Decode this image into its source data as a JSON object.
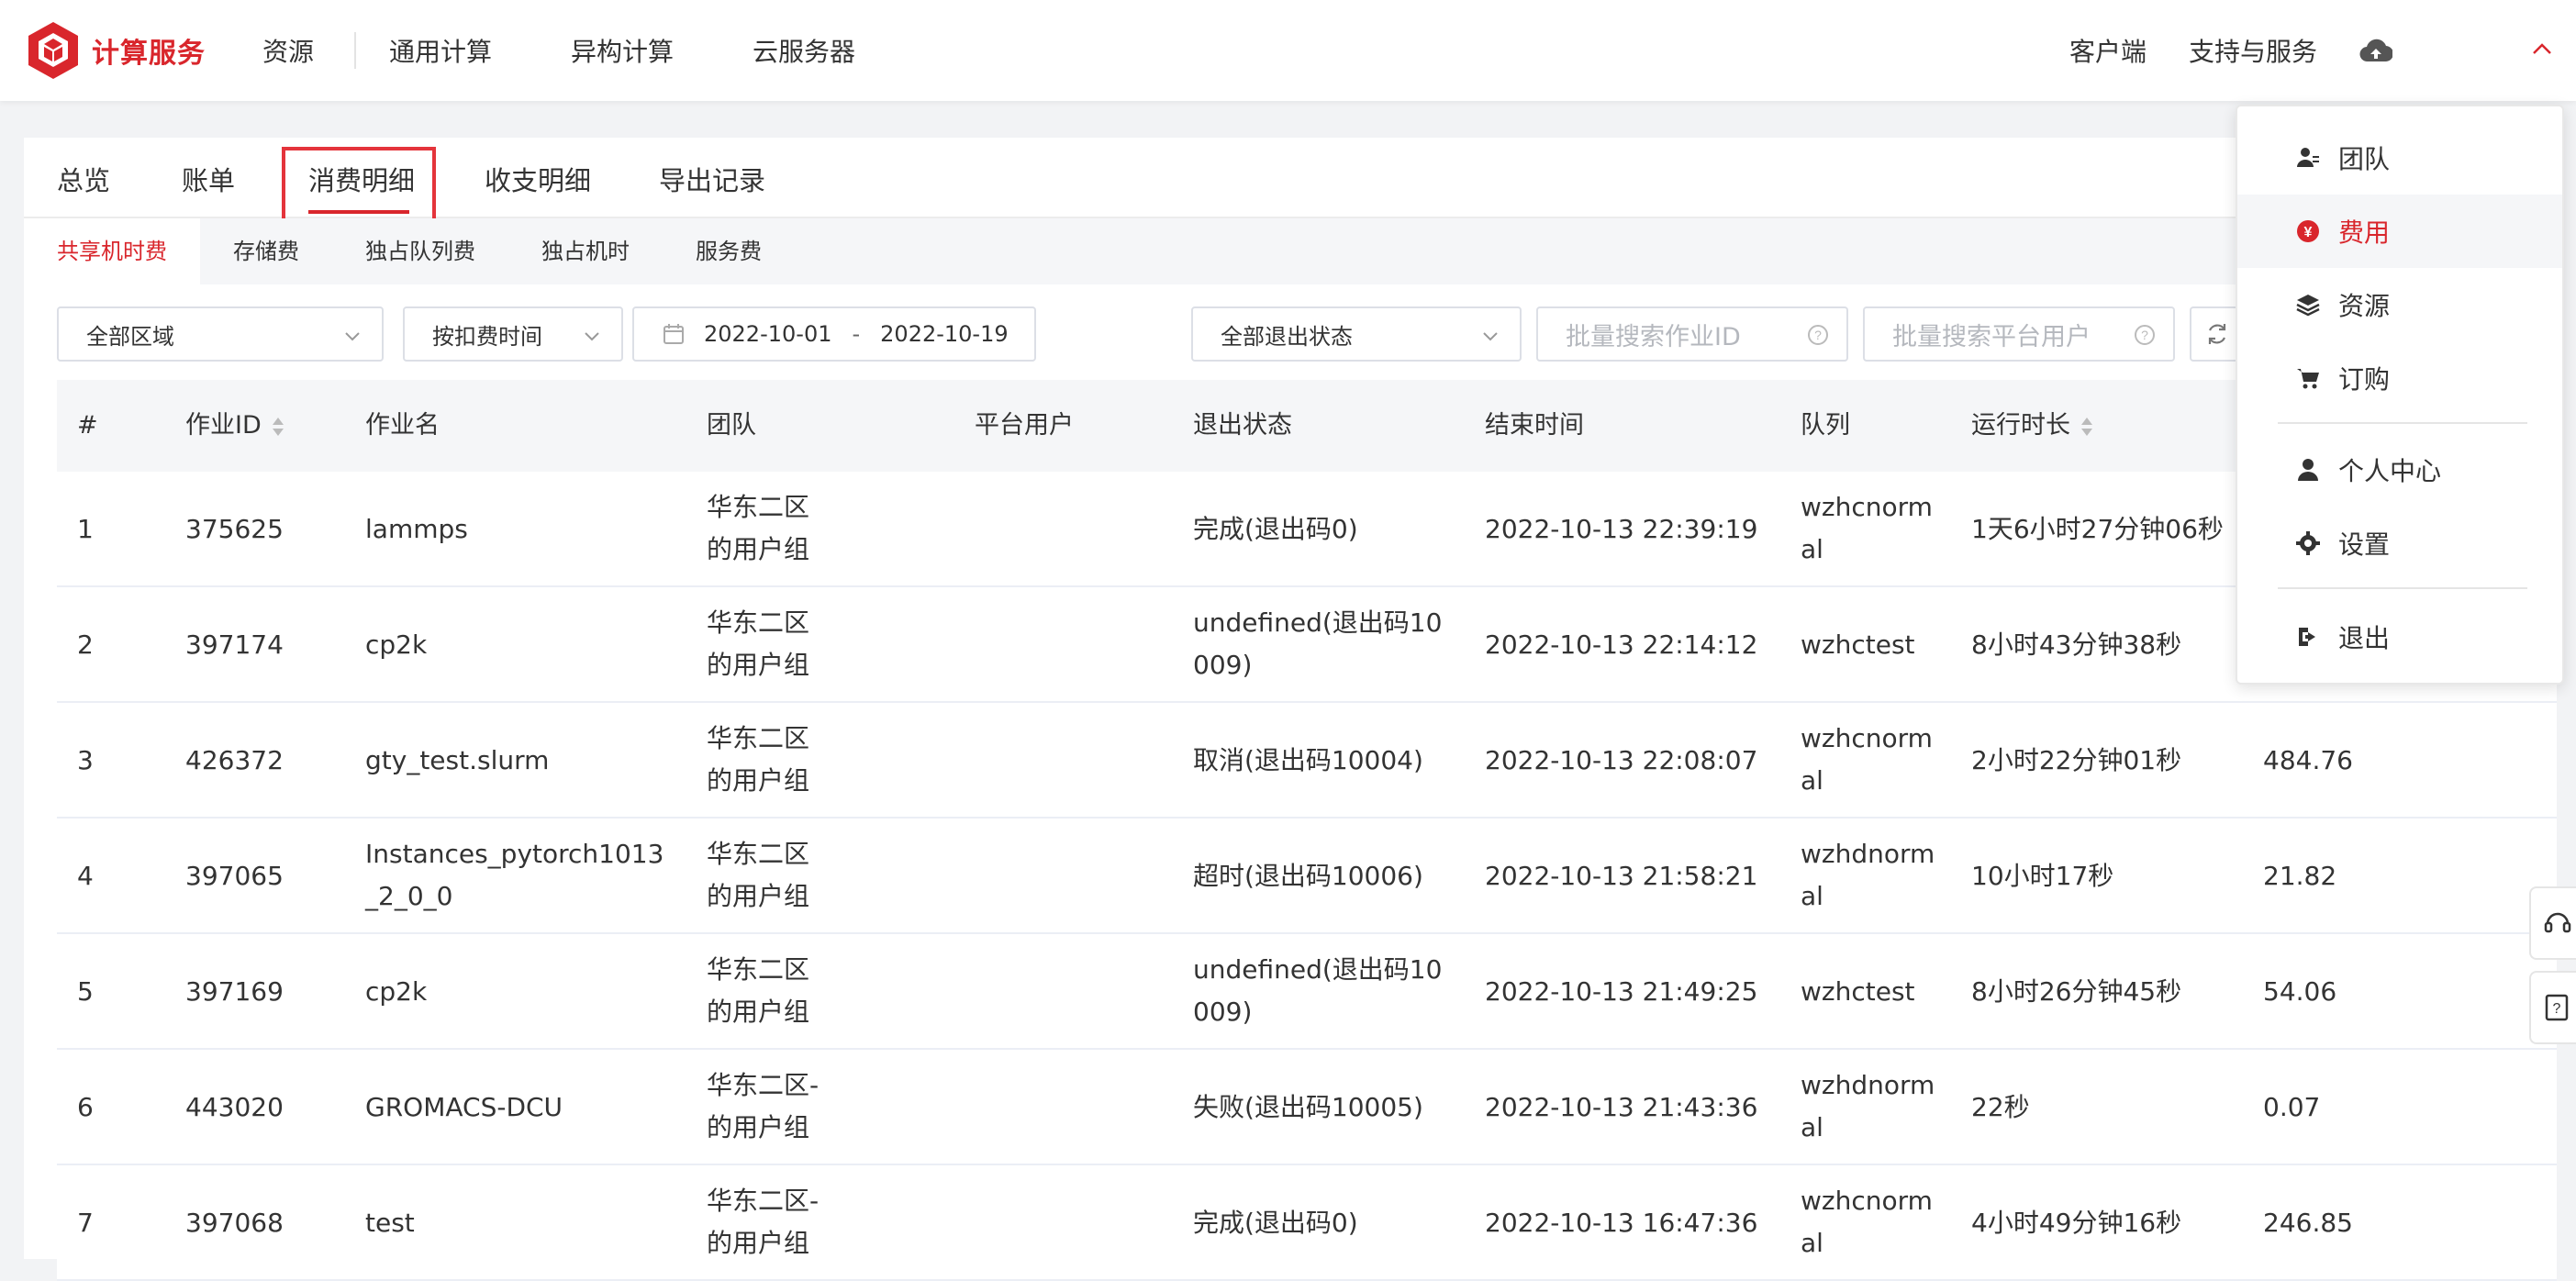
{
  "header": {
    "logo_text": "计算服务",
    "nav_resources": "资源",
    "nav_items": [
      "通用计算",
      "异构计算",
      "云服务器"
    ],
    "right_links": [
      "客户端",
      "支持与服务"
    ],
    "brand_color": "#d9262c"
  },
  "tabs": [
    "总览",
    "账单",
    "消费明细",
    "收支明细",
    "导出记录"
  ],
  "active_tab": "消费明细",
  "subtabs": [
    "共享机时费",
    "存储费",
    "独占队列费",
    "独占机时",
    "服务费"
  ],
  "active_subtab": "共享机时费",
  "filters": {
    "region": "全部区域",
    "time_mode": "按扣费时间",
    "date_start": "2022-10-01",
    "date_sep": "-",
    "date_end": "2022-10-19",
    "exit_status": "全部退出状态",
    "job_id_placeholder": "批量搜索作业ID",
    "user_placeholder": "批量搜索平台用户"
  },
  "table": {
    "columns": [
      "#",
      "作业ID",
      "作业名",
      "团队",
      "平台用户",
      "退出状态",
      "结束时间",
      "队列",
      "运行时长"
    ],
    "rows": [
      {
        "idx": "1",
        "job_id": "375625",
        "name": "lammps",
        "team": "华东二区\n的用户组",
        "user": "",
        "status": "完成(退出码0)",
        "end": "2022-10-13 22:39:19",
        "queue": "wzhcnormal",
        "duration": "1天6小时27分钟06秒",
        "cost": ""
      },
      {
        "idx": "2",
        "job_id": "397174",
        "name": "cp2k",
        "team": "华东二区\n的用户组",
        "user": "",
        "status": "undefined(退出码10009)",
        "end": "2022-10-13 22:14:12",
        "queue": "wzhctest",
        "duration": "8小时43分钟38秒",
        "cost": ""
      },
      {
        "idx": "3",
        "job_id": "426372",
        "name": "gty_test.slurm",
        "team": "华东二区\n的用户组",
        "user": "",
        "status": "取消(退出码10004)",
        "end": "2022-10-13 22:08:07",
        "queue": "wzhcnormal",
        "duration": "2小时22分钟01秒",
        "cost": "484.76"
      },
      {
        "idx": "4",
        "job_id": "397065",
        "name": "Instances_pytorch1013_2_0_0",
        "team": "华东二区\n的用户组",
        "user": "",
        "status": "超时(退出码10006)",
        "end": "2022-10-13 21:58:21",
        "queue": "wzhdnormal",
        "duration": "10小时17秒",
        "cost": "21.82"
      },
      {
        "idx": "5",
        "job_id": "397169",
        "name": "cp2k",
        "team": "华东二区\n的用户组",
        "user": "",
        "status": "undefined(退出码10009)",
        "end": "2022-10-13 21:49:25",
        "queue": "wzhctest",
        "duration": "8小时26分钟45秒",
        "cost": "54.06"
      },
      {
        "idx": "6",
        "job_id": "443020",
        "name": "GROMACS-DCU",
        "team": "华东二区-\n的用户组",
        "user": "",
        "status": "失败(退出码10005)",
        "end": "2022-10-13 21:43:36",
        "queue": "wzhdnormal",
        "duration": "22秒",
        "cost": "0.07"
      },
      {
        "idx": "7",
        "job_id": "397068",
        "name": "test",
        "team": "华东二区-\n的用户组",
        "user": "",
        "status": "完成(退出码0)",
        "end": "2022-10-13 16:47:36",
        "queue": "wzhcnormal",
        "duration": "4小时49分钟16秒",
        "cost": "246.85"
      }
    ]
  },
  "user_menu": {
    "items": [
      "团队",
      "费用",
      "资源",
      "订购",
      "个人中心",
      "设置",
      "退出"
    ],
    "active": "费用",
    "icons": [
      "team-icon",
      "yen-icon",
      "layers-icon",
      "cart-icon",
      "user-icon",
      "gear-icon",
      "logout-icon"
    ]
  }
}
